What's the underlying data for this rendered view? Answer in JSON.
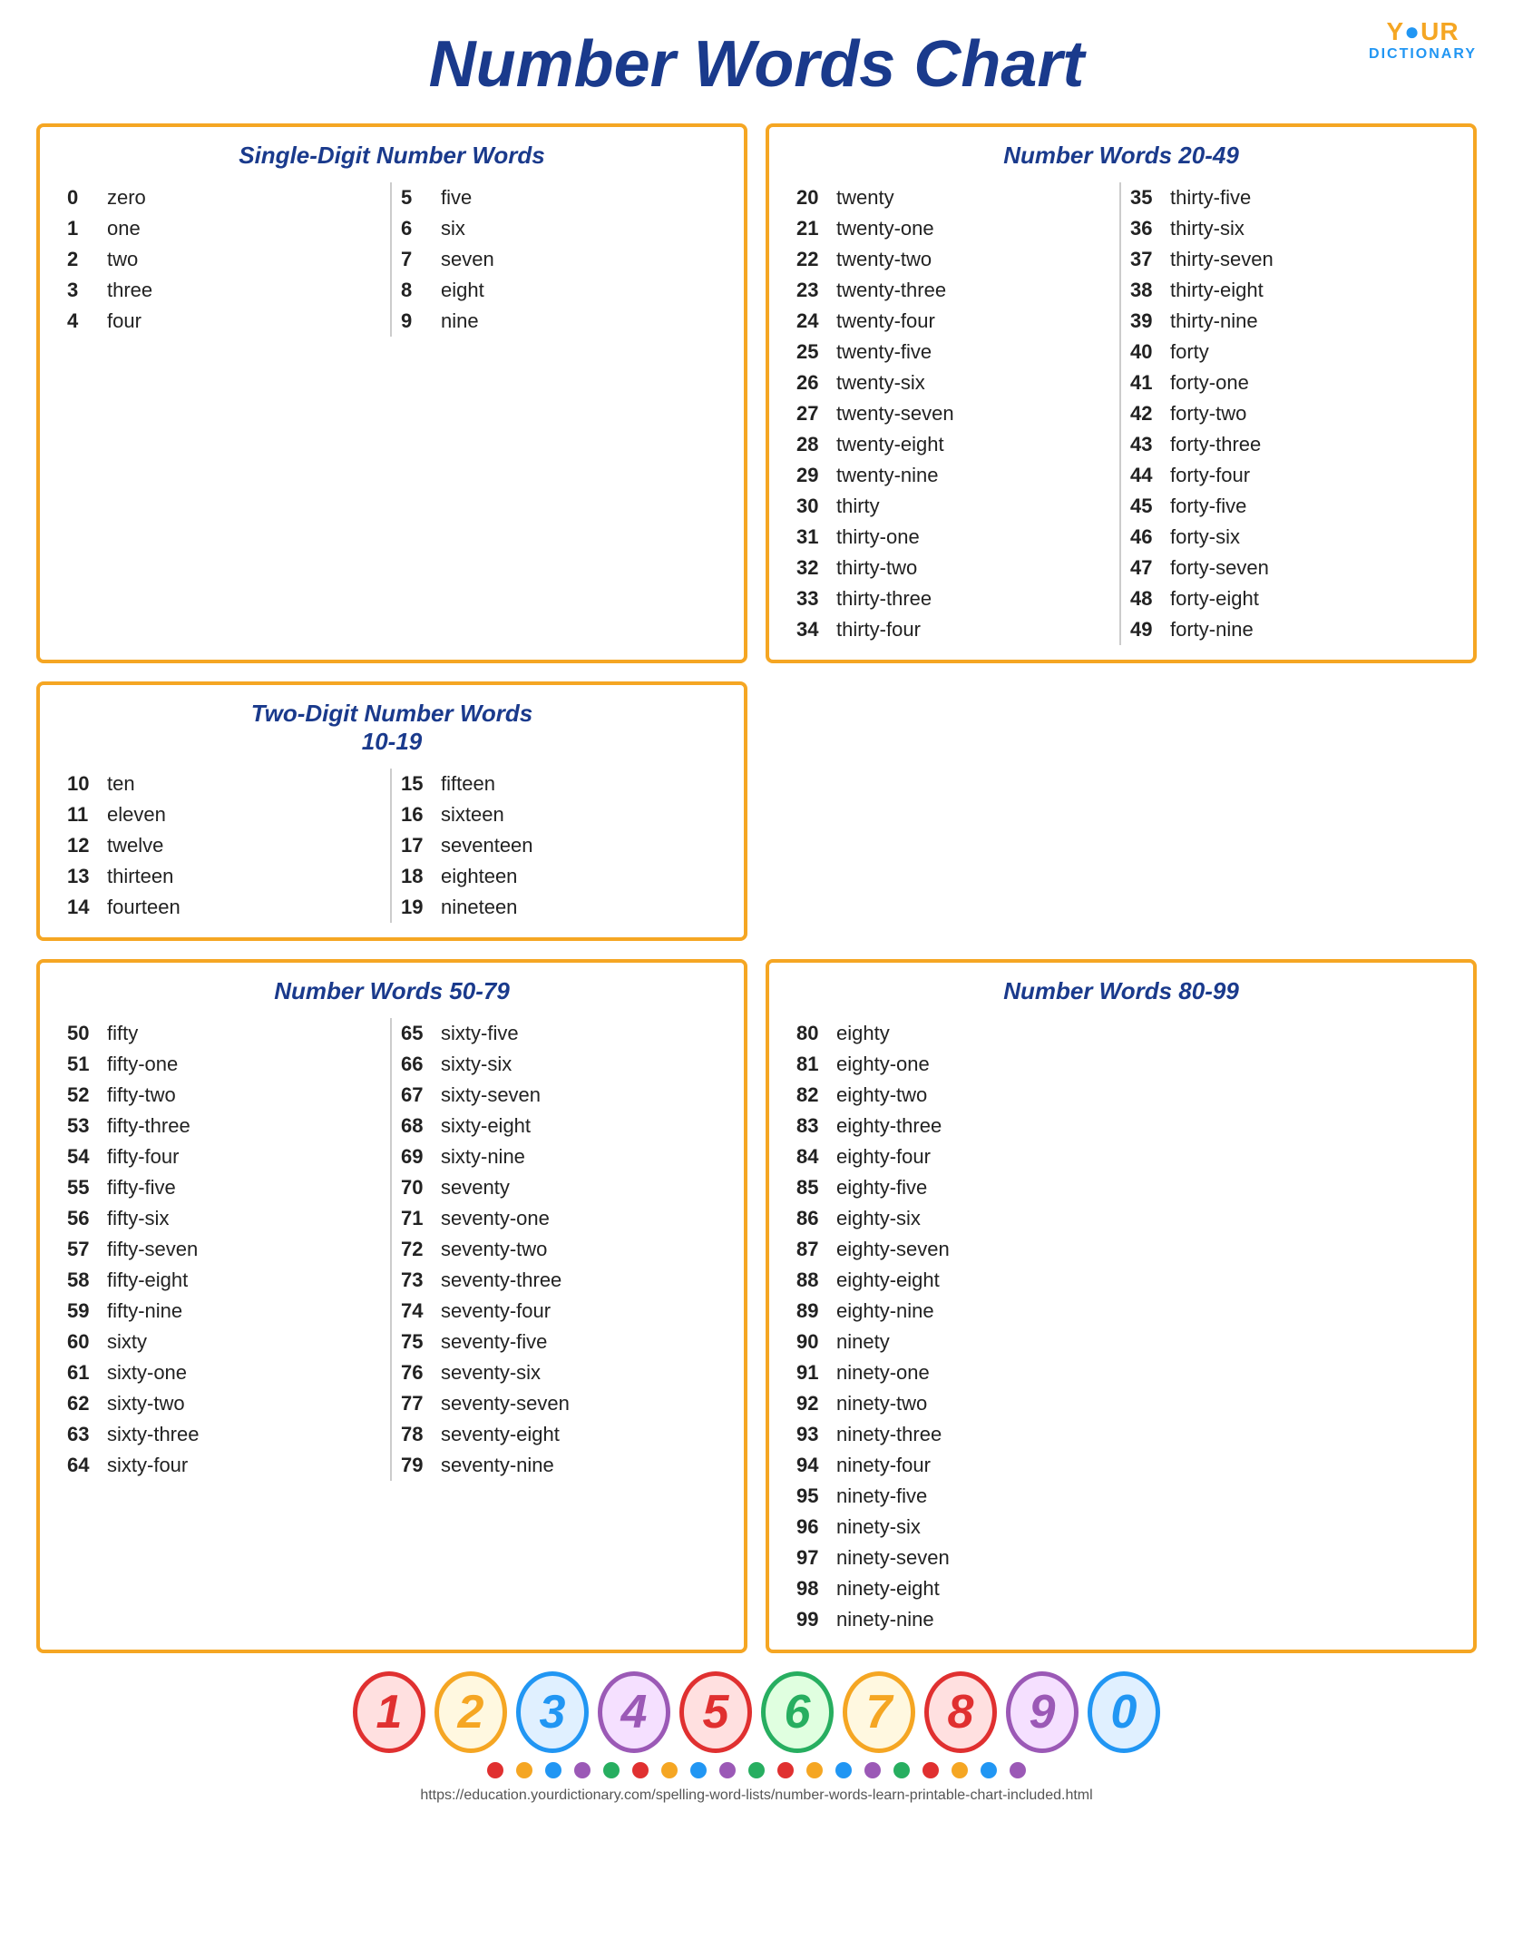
{
  "logo": {
    "your": "Y●UR",
    "dictionary": "DICTIONARY"
  },
  "title": "Number Words Chart",
  "boxes": {
    "single_digit": {
      "title": "Single-Digit Number Words",
      "left": [
        {
          "num": "0",
          "word": "zero"
        },
        {
          "num": "1",
          "word": "one"
        },
        {
          "num": "2",
          "word": "two"
        },
        {
          "num": "3",
          "word": "three"
        },
        {
          "num": "4",
          "word": "four"
        }
      ],
      "right": [
        {
          "num": "5",
          "word": "five"
        },
        {
          "num": "6",
          "word": "six"
        },
        {
          "num": "7",
          "word": "seven"
        },
        {
          "num": "8",
          "word": "eight"
        },
        {
          "num": "9",
          "word": "nine"
        }
      ]
    },
    "two_digit": {
      "title": "Two-Digit Number Words\n10-19",
      "left": [
        {
          "num": "10",
          "word": "ten"
        },
        {
          "num": "11",
          "word": "eleven"
        },
        {
          "num": "12",
          "word": "twelve"
        },
        {
          "num": "13",
          "word": "thirteen"
        },
        {
          "num": "14",
          "word": "fourteen"
        }
      ],
      "right": [
        {
          "num": "15",
          "word": "fifteen"
        },
        {
          "num": "16",
          "word": "sixteen"
        },
        {
          "num": "17",
          "word": "seventeen"
        },
        {
          "num": "18",
          "word": "eighteen"
        },
        {
          "num": "19",
          "word": "nineteen"
        }
      ]
    },
    "words_20_49": {
      "title": "Number Words 20-49",
      "left": [
        {
          "num": "20",
          "word": "twenty"
        },
        {
          "num": "21",
          "word": "twenty-one"
        },
        {
          "num": "22",
          "word": "twenty-two"
        },
        {
          "num": "23",
          "word": "twenty-three"
        },
        {
          "num": "24",
          "word": "twenty-four"
        },
        {
          "num": "25",
          "word": "twenty-five"
        },
        {
          "num": "26",
          "word": "twenty-six"
        },
        {
          "num": "27",
          "word": "twenty-seven"
        },
        {
          "num": "28",
          "word": "twenty-eight"
        },
        {
          "num": "29",
          "word": "twenty-nine"
        },
        {
          "num": "30",
          "word": "thirty"
        },
        {
          "num": "31",
          "word": "thirty-one"
        },
        {
          "num": "32",
          "word": "thirty-two"
        },
        {
          "num": "33",
          "word": "thirty-three"
        },
        {
          "num": "34",
          "word": "thirty-four"
        }
      ],
      "right": [
        {
          "num": "35",
          "word": "thirty-five"
        },
        {
          "num": "36",
          "word": "thirty-six"
        },
        {
          "num": "37",
          "word": "thirty-seven"
        },
        {
          "num": "38",
          "word": "thirty-eight"
        },
        {
          "num": "39",
          "word": "thirty-nine"
        },
        {
          "num": "40",
          "word": "forty"
        },
        {
          "num": "41",
          "word": "forty-one"
        },
        {
          "num": "42",
          "word": "forty-two"
        },
        {
          "num": "43",
          "word": "forty-three"
        },
        {
          "num": "44",
          "word": "forty-four"
        },
        {
          "num": "45",
          "word": "forty-five"
        },
        {
          "num": "46",
          "word": "forty-six"
        },
        {
          "num": "47",
          "word": "forty-seven"
        },
        {
          "num": "48",
          "word": "forty-eight"
        },
        {
          "num": "49",
          "word": "forty-nine"
        }
      ]
    },
    "words_50_79": {
      "title": "Number Words 50-79",
      "left": [
        {
          "num": "50",
          "word": "fifty"
        },
        {
          "num": "51",
          "word": "fifty-one"
        },
        {
          "num": "52",
          "word": "fifty-two"
        },
        {
          "num": "53",
          "word": "fifty-three"
        },
        {
          "num": "54",
          "word": "fifty-four"
        },
        {
          "num": "55",
          "word": "fifty-five"
        },
        {
          "num": "56",
          "word": "fifty-six"
        },
        {
          "num": "57",
          "word": "fifty-seven"
        },
        {
          "num": "58",
          "word": "fifty-eight"
        },
        {
          "num": "59",
          "word": "fifty-nine"
        },
        {
          "num": "60",
          "word": "sixty"
        },
        {
          "num": "61",
          "word": "sixty-one"
        },
        {
          "num": "62",
          "word": "sixty-two"
        },
        {
          "num": "63",
          "word": "sixty-three"
        },
        {
          "num": "64",
          "word": "sixty-four"
        }
      ],
      "right": [
        {
          "num": "65",
          "word": "sixty-five"
        },
        {
          "num": "66",
          "word": "sixty-six"
        },
        {
          "num": "67",
          "word": "sixty-seven"
        },
        {
          "num": "68",
          "word": "sixty-eight"
        },
        {
          "num": "69",
          "word": "sixty-nine"
        },
        {
          "num": "70",
          "word": "seventy"
        },
        {
          "num": "71",
          "word": "seventy-one"
        },
        {
          "num": "72",
          "word": "seventy-two"
        },
        {
          "num": "73",
          "word": "seventy-three"
        },
        {
          "num": "74",
          "word": "seventy-four"
        },
        {
          "num": "75",
          "word": "seventy-five"
        },
        {
          "num": "76",
          "word": "seventy-six"
        },
        {
          "num": "77",
          "word": "seventy-seven"
        },
        {
          "num": "78",
          "word": "seventy-eight"
        },
        {
          "num": "79",
          "word": "seventy-nine"
        }
      ]
    },
    "words_80_99": {
      "title": "Number Words 80-99",
      "col": [
        {
          "num": "80",
          "word": "eighty"
        },
        {
          "num": "81",
          "word": "eighty-one"
        },
        {
          "num": "82",
          "word": "eighty-two"
        },
        {
          "num": "83",
          "word": "eighty-three"
        },
        {
          "num": "84",
          "word": "eighty-four"
        },
        {
          "num": "85",
          "word": "eighty-five"
        },
        {
          "num": "86",
          "word": "eighty-six"
        },
        {
          "num": "87",
          "word": "eighty-seven"
        },
        {
          "num": "88",
          "word": "eighty-eight"
        },
        {
          "num": "89",
          "word": "eighty-nine"
        },
        {
          "num": "90",
          "word": "ninety"
        },
        {
          "num": "91",
          "word": "ninety-one"
        },
        {
          "num": "92",
          "word": "ninety-two"
        },
        {
          "num": "93",
          "word": "ninety-three"
        },
        {
          "num": "94",
          "word": "ninety-four"
        },
        {
          "num": "95",
          "word": "ninety-five"
        },
        {
          "num": "96",
          "word": "ninety-six"
        },
        {
          "num": "97",
          "word": "ninety-seven"
        },
        {
          "num": "98",
          "word": "ninety-eight"
        },
        {
          "num": "99",
          "word": "ninety-nine"
        }
      ]
    }
  },
  "decorative_numbers": [
    "1",
    "2",
    "3",
    "4",
    "5",
    "6",
    "7",
    "8",
    "9",
    "0"
  ],
  "dot_colors": [
    "#e03030",
    "#f5a623",
    "#2196F3",
    "#9b59b6",
    "#27ae60",
    "#e03030",
    "#f5a623",
    "#2196F3",
    "#9b59b6",
    "#27ae60",
    "#e03030",
    "#f5a623",
    "#2196F3",
    "#9b59b6",
    "#27ae60",
    "#e03030",
    "#f5a623",
    "#2196F3",
    "#9b59b6"
  ],
  "footer_url": "https://education.yourdictionary.com/spelling-word-lists/number-words-learn-printable-chart-included.html"
}
